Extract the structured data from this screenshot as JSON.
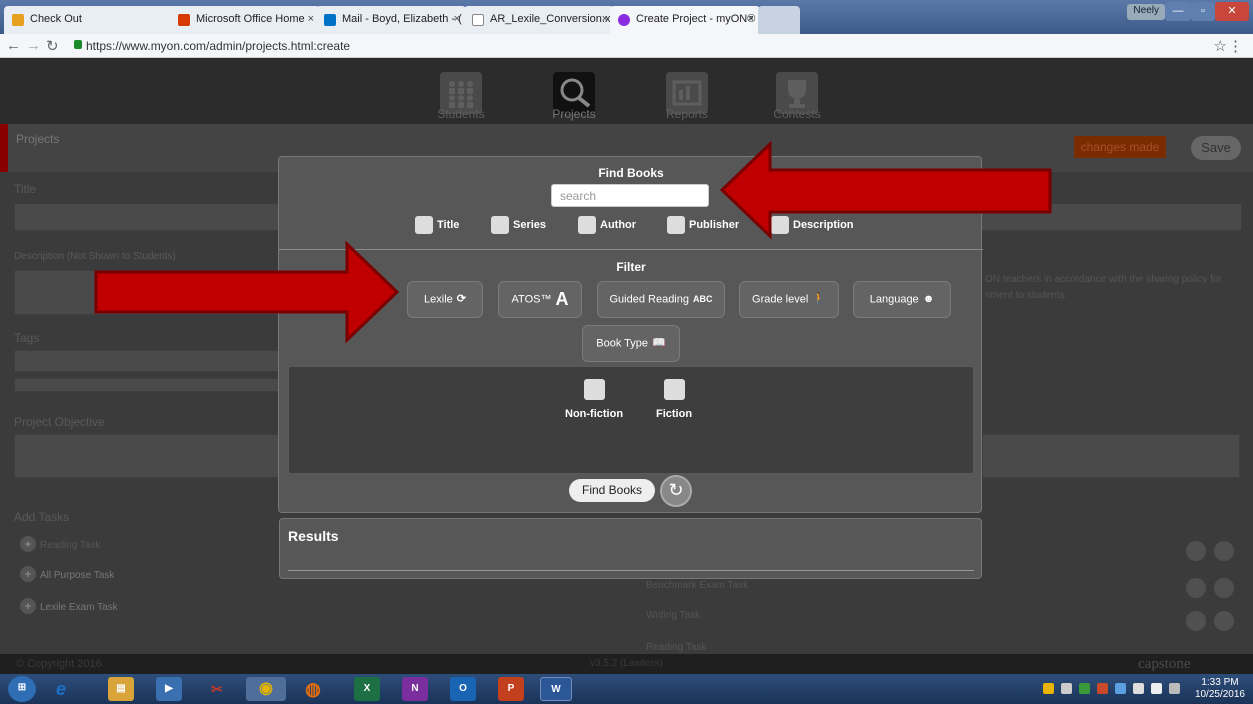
{
  "browser": {
    "tabs": [
      {
        "label": "Check Out",
        "color": "#e8a020"
      },
      {
        "label": "Microsoft Office Home",
        "color": "#d83b01"
      },
      {
        "label": "Mail - Boyd, Elizabeth - (",
        "color": "#0072c6"
      },
      {
        "label": "AR_Lexile_Conversion.xls",
        "color": "#888888"
      },
      {
        "label": "Create Project - myON®",
        "color": "#8a2be2"
      }
    ],
    "user": "Neely",
    "url": "https://www.myon.com/admin/projects.html:create",
    "close_glyph": "×"
  },
  "app_nav": {
    "items": [
      {
        "label": "Students",
        "icon": "students-icon"
      },
      {
        "label": "Projects",
        "icon": "projects-icon"
      },
      {
        "label": "Reports",
        "icon": "reports-icon"
      },
      {
        "label": "Contests",
        "icon": "contests-icon"
      }
    ]
  },
  "page": {
    "projects_title": "Projects",
    "changes_badge": "changes made",
    "save_label": "Save",
    "title_label": "Title",
    "description_label": "Description",
    "description_note": "(Not Shown to Students)",
    "tags_label": "Tags",
    "objective_label": "Project Objective",
    "add_tasks_label": "Add Tasks",
    "share_text_1": "ON teachers in accordance with the sharing policy for",
    "share_text_2": "nment to students.",
    "tasks_left": [
      "Reading Task",
      "All Purpose Task",
      "Lexile Exam Task"
    ],
    "tasks_right": [
      "Benchmark Exam Task",
      "Writing Task",
      "Reading Task"
    ],
    "footer_copy": "© Copyright 2016",
    "footer_version": "v3.5.2 (Lawless)",
    "footer_brand": "capstone"
  },
  "modal": {
    "title": "Find Books",
    "search_placeholder": "search",
    "search_fields": [
      "Title",
      "Series",
      "Author",
      "Publisher",
      "Description"
    ],
    "filter_title": "Filter",
    "filters": [
      {
        "label": "Lexile",
        "glyph": "⟳"
      },
      {
        "label": "ATOS™",
        "glyph": "A"
      },
      {
        "label": "Guided Reading",
        "glyph": "ABC"
      },
      {
        "label": "Grade level",
        "glyph": "🚶"
      },
      {
        "label": "Language",
        "glyph": "☻"
      },
      {
        "label": "Book Type",
        "glyph": "📖"
      }
    ],
    "book_types": [
      "Non-fiction",
      "Fiction"
    ],
    "find_label": "Find Books",
    "reset_glyph": "↻",
    "results_title": "Results"
  },
  "taskbar": {
    "apps": [
      {
        "label": "⊞",
        "color": "#2f6db5"
      },
      {
        "label": "e",
        "color": "#1e6fc7"
      },
      {
        "label": "▤",
        "color": "#d9a53a"
      },
      {
        "label": "▶",
        "color": "#3a6fb0"
      },
      {
        "label": "✂",
        "color": "#c0392b"
      },
      {
        "label": "◉",
        "color": "#e2b400"
      },
      {
        "label": "◍",
        "color": "#e06d10"
      },
      {
        "label": "X",
        "color": "#1d7044"
      },
      {
        "label": "N",
        "color": "#7b2f9e"
      },
      {
        "label": "O",
        "color": "#1a64b4"
      },
      {
        "label": "P",
        "color": "#c3401f"
      },
      {
        "label": "W",
        "color": "#2b5797"
      }
    ],
    "time": "1:33 PM",
    "date": "10/25/2016"
  },
  "colors": {
    "arrow": "#c00000",
    "arrow_border": "#7a0000"
  }
}
